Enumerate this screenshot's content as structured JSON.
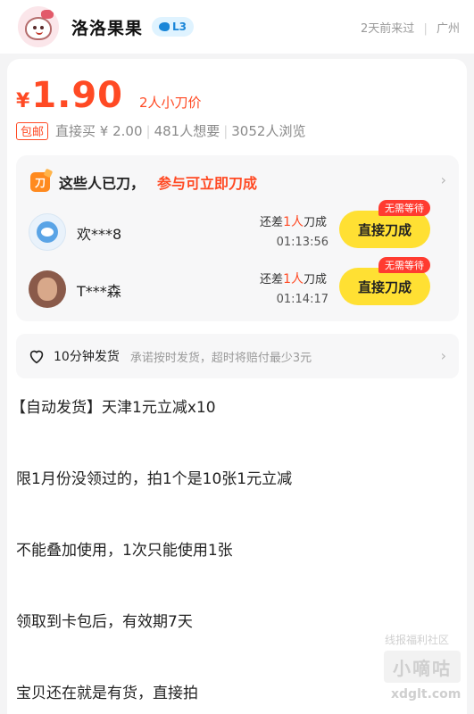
{
  "seller": {
    "name": "洛洛果果",
    "badge": "L3",
    "last_seen": "2天前来过",
    "separator": "|",
    "location": "广州"
  },
  "price": {
    "symbol": "¥",
    "value": "1.90",
    "tag": "2人小刀价"
  },
  "sub": {
    "shipping_badge": "包邮",
    "direct_buy": "直接买 ¥ 2.00",
    "wants": "481人想要",
    "views": "3052人浏览",
    "sep": "|"
  },
  "bargain": {
    "title": "这些人已刀，",
    "title_accent": "参与可立即刀成",
    "knife_icon_text": "刀",
    "items": [
      {
        "user": "欢***8",
        "need_prefix": "还差",
        "need_num": "1人",
        "need_suffix": "刀成",
        "countdown": "01:13:56",
        "button": "直接刀成",
        "badge": "无需等待"
      },
      {
        "user": "T***森",
        "need_prefix": "还差",
        "need_num": "1人",
        "need_suffix": "刀成",
        "countdown": "01:14:17",
        "button": "直接刀成",
        "badge": "无需等待"
      }
    ]
  },
  "shipping": {
    "title": "10分钟发货",
    "desc": "承诺按时发货，超时将赔付最少3元"
  },
  "description": [
    "【自动发货】天津1元立减x10",
    "限1月份没领过的，拍1个是10张1元立减",
    "不能叠加使用，1次只能使用1张",
    "领取到卡包后，有效期7天",
    "宝贝还在就是有货，直接拍"
  ],
  "watermark": {
    "top": "线报福利社区",
    "brand": "小嘀咕",
    "url": "xdglt.com"
  },
  "icons": {
    "chevron": "›",
    "fish": "fish-icon",
    "heart": "heart-icon",
    "knife": "knife-icon"
  },
  "colors": {
    "accent": "#ff4a24",
    "button": "#ffe033",
    "badge": "#ff3b30",
    "level_bg": "#dff3ff",
    "level_text": "#1a86d8"
  }
}
